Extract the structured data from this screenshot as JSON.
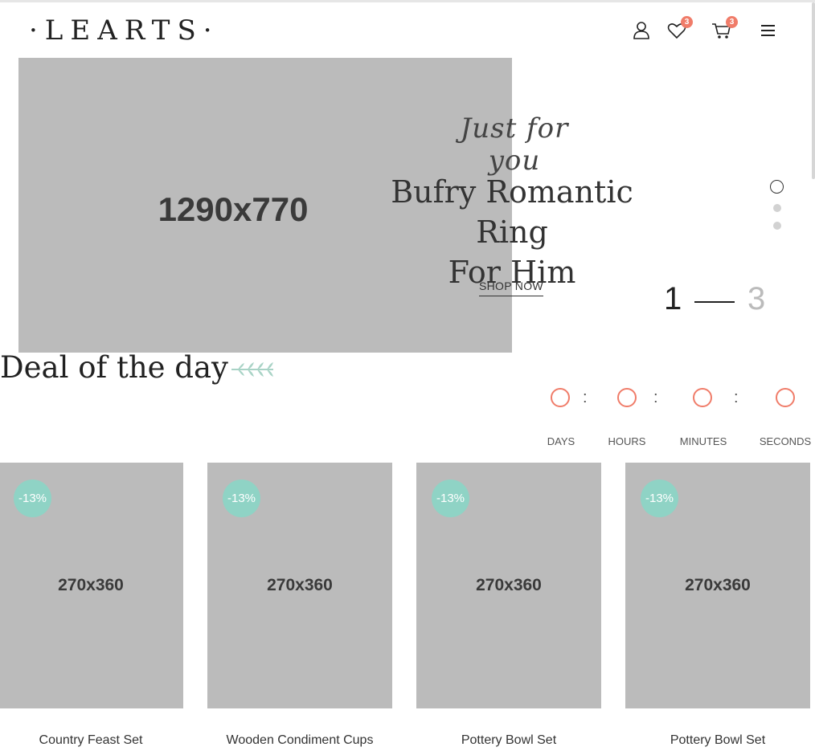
{
  "header": {
    "logo": "·LEARTS·",
    "wishlist_count": "3",
    "cart_count": "3",
    "icons": [
      "user-icon",
      "heart-icon",
      "cart-icon",
      "menu-icon"
    ]
  },
  "hero": {
    "image_placeholder": "1290x770",
    "script_text": "Just for you",
    "title_line1": "Bufry Romantic Ring",
    "title_line2": "For Him",
    "cta": "SHOP NOW",
    "slide_current": "1",
    "slide_total": "3"
  },
  "deal": {
    "title": "Deal of the day",
    "countdown_labels": [
      "DAYS",
      "HOURS",
      "MINUTES",
      "SECONDS"
    ],
    "separator": ":"
  },
  "products": [
    {
      "image_placeholder": "270x360",
      "discount": "-13%",
      "name": "Country Feast Set"
    },
    {
      "image_placeholder": "270x360",
      "discount": "-13%",
      "name": "Wooden Condiment Cups"
    },
    {
      "image_placeholder": "270x360",
      "discount": "-13%",
      "name": "Pottery Bowl Set"
    },
    {
      "image_placeholder": "270x360",
      "discount": "-13%",
      "name": "Pottery Bowl Set"
    }
  ],
  "colors": {
    "accent": "#f07c69",
    "discount_badge": "#8fd3c5",
    "placeholder": "#bbbbbb",
    "leaf": "#a9d3c6"
  }
}
